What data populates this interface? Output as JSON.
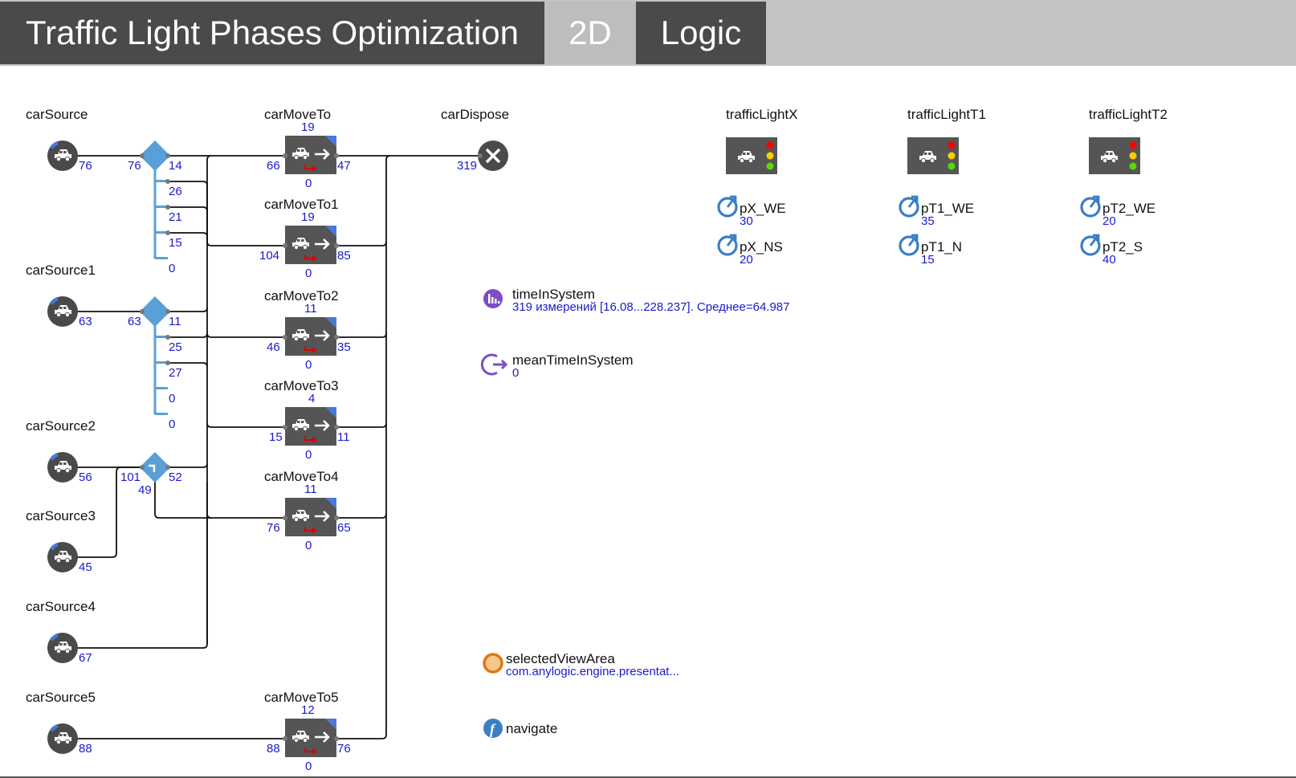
{
  "header": {
    "title": "Traffic Light Phases Optimization",
    "tabs": [
      "2D",
      "Logic"
    ]
  },
  "sources": [
    {
      "name": "carSource",
      "count": "76"
    },
    {
      "name": "carSource1",
      "count": "63"
    },
    {
      "name": "carSource2",
      "count": "56"
    },
    {
      "name": "carSource3",
      "count": "45"
    },
    {
      "name": "carSource4",
      "count": "67"
    },
    {
      "name": "carSource5",
      "count": "88"
    }
  ],
  "selects": [
    {
      "in": "76",
      "outs": [
        "14",
        "26",
        "21",
        "15",
        "0"
      ]
    },
    {
      "in": "63",
      "outs": [
        "11",
        "25",
        "27",
        "0",
        "0"
      ]
    },
    {
      "in": "101",
      "outs": [
        "52",
        "49"
      ]
    }
  ],
  "moveTo": [
    {
      "name": "carMoveTo",
      "top": "19",
      "in": "66",
      "out": "47",
      "bottom": "0"
    },
    {
      "name": "carMoveTo1",
      "top": "19",
      "in": "104",
      "out": "85",
      "bottom": "0"
    },
    {
      "name": "carMoveTo2",
      "top": "11",
      "in": "46",
      "out": "35",
      "bottom": "0"
    },
    {
      "name": "carMoveTo3",
      "top": "4",
      "in": "15",
      "out": "11",
      "bottom": "0"
    },
    {
      "name": "carMoveTo4",
      "top": "11",
      "in": "76",
      "out": "65",
      "bottom": "0"
    },
    {
      "name": "carMoveTo5",
      "top": "12",
      "in": "88",
      "out": "76",
      "bottom": "0"
    }
  ],
  "dispose": {
    "name": "carDispose",
    "count": "319"
  },
  "trafficLights": [
    {
      "name": "trafficLightX",
      "params": [
        {
          "name": "pX_WE",
          "value": "30"
        },
        {
          "name": "pX_NS",
          "value": "20"
        }
      ]
    },
    {
      "name": "trafficLightT1",
      "params": [
        {
          "name": "pT1_WE",
          "value": "35"
        },
        {
          "name": "pT1_N",
          "value": "15"
        }
      ]
    },
    {
      "name": "trafficLightT2",
      "params": [
        {
          "name": "pT2_WE",
          "value": "20"
        },
        {
          "name": "pT2_S",
          "value": "40"
        }
      ]
    }
  ],
  "timeInSystem": {
    "name": "timeInSystem",
    "stats": "319 измерений [16.08...228.237]. Среднее=64.987"
  },
  "meanTimeInSystem": {
    "name": "meanTimeInSystem",
    "value": "0"
  },
  "selectedViewArea": {
    "name": "selectedViewArea",
    "value": "com.anylogic.engine.presentat..."
  },
  "navigate": {
    "name": "navigate"
  },
  "colors": {
    "header_dark": "#4a4a4a",
    "header_bg": "#c4c4c4",
    "tab_active": "#bdbdbd",
    "counter": "#1a1acc",
    "select_blue": "#5aa0d6",
    "node_dark": "#555555"
  }
}
